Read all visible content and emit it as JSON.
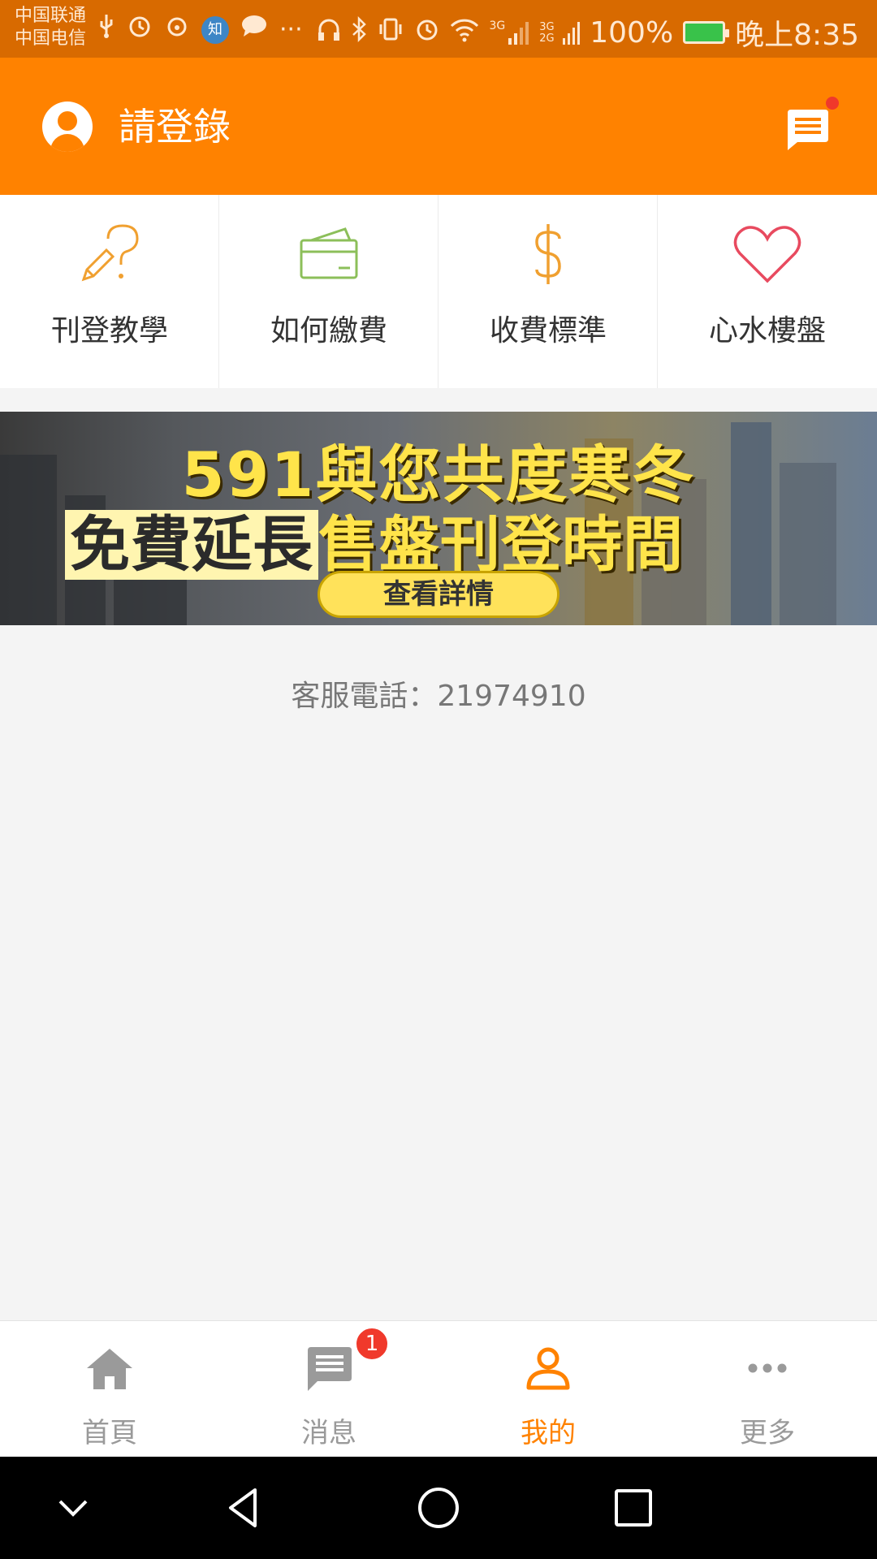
{
  "status_bar": {
    "carrier_1": "中国联通",
    "carrier_2": "中国电信",
    "zhihu_label": "知",
    "ellipsis": "···",
    "network_1": "3G",
    "network_2": "3G 2G",
    "battery": "100%",
    "time": "晚上8:35"
  },
  "header": {
    "title": "請登錄",
    "has_notification_dot": true
  },
  "quick_menu": [
    {
      "label": "刊登教學",
      "icon": "pencil-question-icon",
      "color": "#f0a030"
    },
    {
      "label": "如何繳費",
      "icon": "card-icon",
      "color": "#8cbf5a"
    },
    {
      "label": "收費標準",
      "icon": "dollar-icon",
      "color": "#f0a030"
    },
    {
      "label": "心水樓盤",
      "icon": "heart-icon",
      "color": "#e84a5f"
    }
  ],
  "banner": {
    "line1": "591與您共度寒冬",
    "line2_highlight": "免費延長",
    "line2_rest": "售盤刊登時間",
    "cta": "查看詳情"
  },
  "customer_service": "客服電話：21974910",
  "bottom_nav": [
    {
      "label": "首頁",
      "icon": "home-icon",
      "active": false
    },
    {
      "label": "消息",
      "icon": "message-icon",
      "active": false,
      "badge": "1"
    },
    {
      "label": "我的",
      "icon": "profile-icon",
      "active": true
    },
    {
      "label": "更多",
      "icon": "more-icon",
      "active": false
    }
  ],
  "colors": {
    "brand": "#ff8200",
    "status_bar": "#d86a00",
    "badge": "#f0392b"
  }
}
